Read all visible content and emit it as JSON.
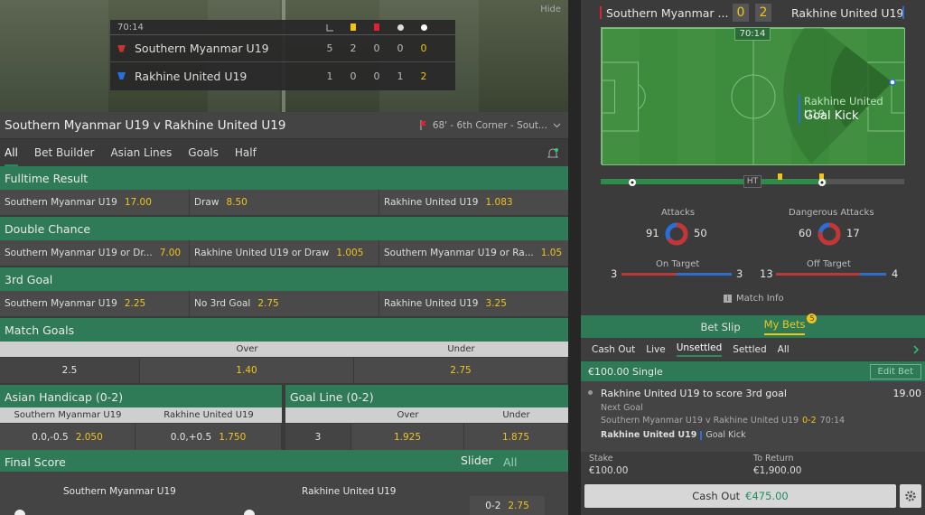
{
  "video": {
    "hide": "Hide",
    "clock": "70:14",
    "teams": [
      {
        "name": "Southern Myanmar U19",
        "stats": [
          "5",
          "2",
          "0",
          "0",
          "0"
        ]
      },
      {
        "name": "Rakhine United U19",
        "stats": [
          "1",
          "0",
          "0",
          "1",
          "2"
        ]
      }
    ]
  },
  "title": "Southern Myanmar U19 v Rakhine United U19",
  "event": "68' - 6th Corner - Sout...",
  "tabs": [
    "All",
    "Bet Builder",
    "Asian Lines",
    "Goals",
    "Half"
  ],
  "fulltime": {
    "title": "Fulltime Result",
    "c": [
      [
        "Southern Myanmar U19",
        "17.00"
      ],
      [
        "Draw",
        "8.50"
      ],
      [
        "Rakhine United U19",
        "1.083"
      ]
    ]
  },
  "double": {
    "title": "Double Chance",
    "c": [
      [
        "Southern Myanmar U19 or Dr...",
        "7.00"
      ],
      [
        "Rakhine United U19 or Draw",
        "1.005"
      ],
      [
        "Southern Myanmar U19 or Ra...",
        "1.05"
      ]
    ]
  },
  "third": {
    "title": "3rd Goal",
    "c": [
      [
        "Southern Myanmar U19",
        "2.25"
      ],
      [
        "No 3rd Goal",
        "2.75"
      ],
      [
        "Rakhine United U19",
        "3.25"
      ]
    ]
  },
  "match_goals": {
    "title": "Match Goals",
    "over": "Over",
    "under": "Under",
    "line": "2.5",
    "over_odd": "1.40",
    "under_odd": "2.75"
  },
  "asian": {
    "title": "Asian Handicap (0-2)",
    "h1": "Southern Myanmar U19",
    "h2": "Rakhine United U19",
    "l1": "0.0,-0.5",
    "o1": "2.050",
    "l2": "0.0,+0.5",
    "o2": "1.750"
  },
  "goalline": {
    "title": "Goal Line (0-2)",
    "over": "Over",
    "under": "Under",
    "line": "3",
    "over_odd": "1.925",
    "under_odd": "1.875"
  },
  "final": {
    "title": "Final Score",
    "slider": "Slider",
    "all": "All",
    "t1": "Southern Myanmar U19",
    "t2": "Rakhine United U19",
    "score": "0-2",
    "odd": "2.75"
  },
  "right": {
    "home": "Southern Myanmar ...",
    "away": "Rakhine United U19",
    "hs": "0",
    "as": "2",
    "clock": "70:14",
    "pitch_team": "Rakhine United U19",
    "pitch_event": "Goal Kick",
    "ht": "HT",
    "attacks": {
      "label": "Attacks",
      "h": "91",
      "a": "50"
    },
    "dangerous": {
      "label": "Dangerous Attacks",
      "h": "60",
      "a": "17"
    },
    "on_target": {
      "label": "On Target",
      "h": "3",
      "a": "3"
    },
    "off_target": {
      "label": "Off Target",
      "h": "13",
      "a": "4"
    },
    "match_info": "Match Info"
  },
  "betslip": {
    "tab1": "Bet Slip",
    "tab2": "My Bets",
    "badge": "5",
    "sub": [
      "Cash Out",
      "Live",
      "Unsettled",
      "Settled",
      "All"
    ],
    "head": "€100.00 Single",
    "edit": "Edit Bet",
    "selection": "Rakhine United U19 to score 3rd goal",
    "price": "19.00",
    "market": "Next Goal",
    "fixture": "Southern Myanmar U19 v Rakhine United U19",
    "fscore": "0-2",
    "ftime": "70:14",
    "last_team": "Rakhine United U19",
    "last_event": "Goal Kick",
    "stake_l": "Stake",
    "stake": "€100.00",
    "ret_l": "To Return",
    "ret": "€1,900.00",
    "cashout_l": "Cash Out",
    "cashout": "€475.00"
  }
}
